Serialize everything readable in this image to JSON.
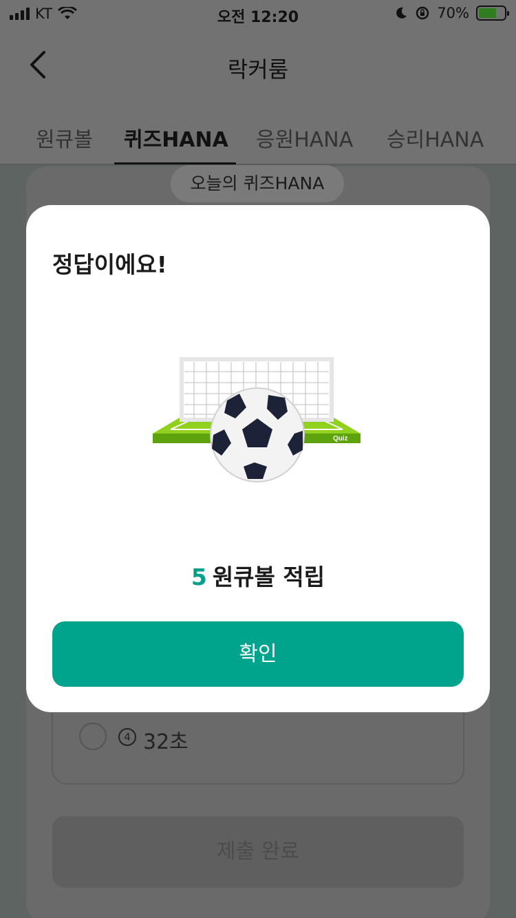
{
  "status_bar": {
    "carrier": "KT",
    "time": "오전 12:20",
    "battery_percent": "70%"
  },
  "header": {
    "title": "락커룸"
  },
  "tabs": [
    {
      "label": "원큐볼"
    },
    {
      "label": "퀴즈HANA"
    },
    {
      "label": "응원HANA"
    },
    {
      "label": "승리HANA"
    }
  ],
  "content": {
    "quiz_pill": "오늘의 퀴즈HANA",
    "option4_number": "4",
    "option4_label": "32초",
    "submit_label": "제출 완료"
  },
  "modal": {
    "title": "정답이에요!",
    "badge_text": "Quiz",
    "reward_amount": "5",
    "reward_text": "원큐볼 적립",
    "confirm_label": "확인"
  },
  "colors": {
    "accent": "#00a38c",
    "accent_text": "#00a08a",
    "grass": "#7fc21a"
  },
  "icons": [
    "back-chevron-icon",
    "signal-icon",
    "wifi-icon",
    "moon-icon",
    "rotation-lock-icon",
    "battery-charging-icon",
    "soccer-goal-illustration"
  ]
}
